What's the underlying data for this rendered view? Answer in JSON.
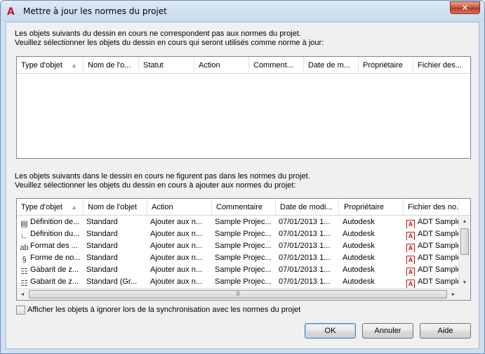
{
  "window": {
    "title": "Mettre à jour les normes du projet",
    "close_glyph": "✕"
  },
  "section1": {
    "caption_line1": "Les objets suivants du dessin en cours ne correspondent pas aux normes du projet.",
    "caption_line2": "Veuillez sélectionner les objets du dessin en cours qui seront utilisés comme norme à jour:",
    "columns": [
      "Type d'objet",
      "Nom de l'o...",
      "Statut",
      "Action",
      "Comment...",
      "Date de m...",
      "Propriétaire",
      "Fichier des..."
    ],
    "rows": []
  },
  "section2": {
    "caption_line1": "Les objets suivants dans le dessin en cours ne figurent pas dans les normes du projet.",
    "caption_line2": "Veuillez sélectionner les objets du dessin en cours à ajouter aux normes du projet:",
    "columns": [
      "Type d'objet",
      "Nom de l'objet",
      "Action",
      "Commentaire",
      "Date de modi...",
      "Propriétaire",
      "Fichier des no..."
    ],
    "rows": [
      {
        "icon": "material-definition-icon",
        "glyph": "▤",
        "type": "Définition de...",
        "name": "Standard",
        "action": "Ajouter aux n...",
        "comment": "Sample Projec...",
        "date": "07/01/2013 1...",
        "owner": "Autodesk",
        "file": "ADT Sample"
      },
      {
        "icon": "profile-definition-icon",
        "glyph": "∟",
        "type": "Définition du...",
        "name": "Standard",
        "action": "Ajouter aux n...",
        "comment": "Sample Projec...",
        "date": "07/01/2013 1...",
        "owner": "Autodesk",
        "file": "ADT Sample"
      },
      {
        "icon": "text-format-icon",
        "glyph": "ab",
        "type": "Format des ...",
        "name": "Standard",
        "action": "Ajouter aux n...",
        "comment": "Sample Projec...",
        "date": "07/01/2013 1...",
        "owner": "Autodesk",
        "file": "ADT Sample"
      },
      {
        "icon": "shape-definition-icon",
        "glyph": "§",
        "type": "Forme de no...",
        "name": "Standard",
        "action": "Ajouter aux n...",
        "comment": "Sample Projec...",
        "date": "07/01/2013 1...",
        "owner": "Autodesk",
        "file": "ADT Sample"
      },
      {
        "icon": "zone-template-icon",
        "glyph": "☷",
        "type": "Gabarit de z...",
        "name": "Standard",
        "action": "Ajouter aux n...",
        "comment": "Sample Projec...",
        "date": "07/01/2013 1...",
        "owner": "Autodesk",
        "file": "ADT Sample"
      },
      {
        "icon": "zone-template-icon",
        "glyph": "☷",
        "type": "Gabarit de z...",
        "name": "Standard (Gr...",
        "action": "Ajouter aux n...",
        "comment": "Sample Projec...",
        "date": "07/01/2013 1...",
        "owner": "Autodesk",
        "file": "ADT Sample"
      }
    ],
    "file_icon_glyph": "A"
  },
  "options": {
    "ignored_checkbox_label": "Afficher les objets à ignorer lors de la synchronisation avec les normes du projet",
    "ignored_checked": false
  },
  "buttons": {
    "ok": "OK",
    "cancel": "Annuler",
    "help": "Aide"
  },
  "scroll_glyphs": {
    "up": "▲",
    "down": "▼",
    "left": "◄",
    "right": "►",
    "thumb_grip": "|||",
    "sort": "▲"
  }
}
